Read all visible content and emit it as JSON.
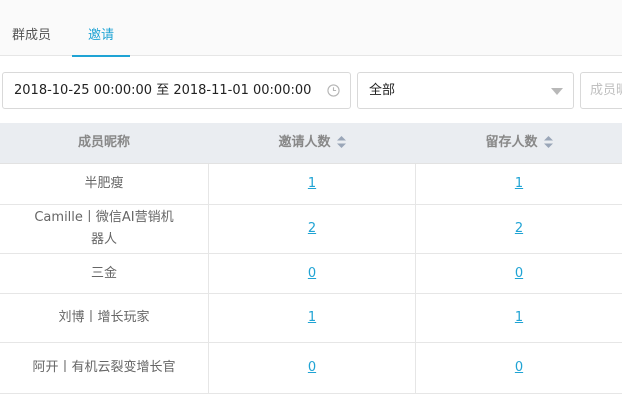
{
  "tabs": [
    {
      "label": "群成员",
      "active": false
    },
    {
      "label": "邀请",
      "active": true
    }
  ],
  "filters": {
    "date_range": "2018-10-25 00:00:00 至 2018-11-01 00:00:00",
    "select_value": "全部",
    "member_placeholder": "成员昵"
  },
  "table": {
    "headers": [
      "成员昵称",
      "邀请人数",
      "留存人数"
    ],
    "rows": [
      {
        "name": "半肥瘦",
        "invited": "1",
        "retained": "1"
      },
      {
        "name": "Camille丨微信AI营销机器人",
        "invited": "2",
        "retained": "2"
      },
      {
        "name": "三金",
        "invited": "0",
        "retained": "0"
      },
      {
        "name": "刘博丨增长玩家",
        "invited": "1",
        "retained": "1"
      },
      {
        "name": "阿开丨有机云裂变增长官",
        "invited": "0",
        "retained": "0"
      }
    ]
  },
  "colors": {
    "accent": "#1fa3d4",
    "header_bg": "#eaedf1"
  }
}
